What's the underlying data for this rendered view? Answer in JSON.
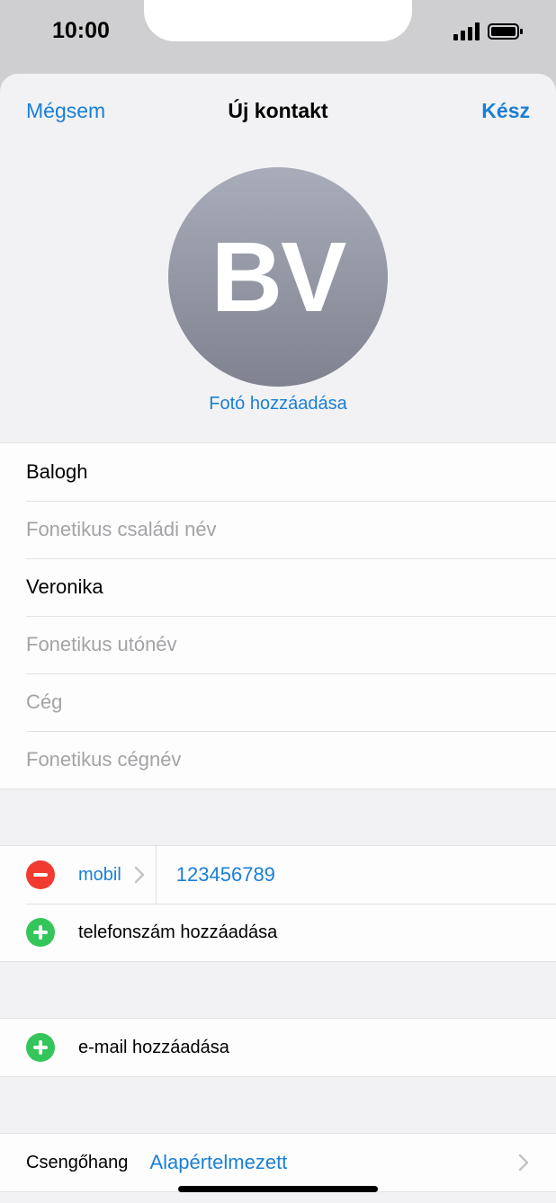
{
  "status": {
    "time": "10:00"
  },
  "nav": {
    "cancel": "Mégsem",
    "title": "Új kontakt",
    "done": "Kész"
  },
  "avatar": {
    "initials": "BV",
    "add_photo": "Fotó hozzáadása"
  },
  "name_fields": {
    "last_name": {
      "value": "Balogh",
      "placeholder": ""
    },
    "phonetic_last": {
      "value": "",
      "placeholder": "Fonetikus családi név"
    },
    "first_name": {
      "value": "Veronika",
      "placeholder": ""
    },
    "phonetic_first": {
      "value": "",
      "placeholder": "Fonetikus utónév"
    },
    "company": {
      "value": "",
      "placeholder": "Cég"
    },
    "phonetic_company": {
      "value": "",
      "placeholder": "Fonetikus cégnév"
    }
  },
  "phone": {
    "label": "mobil",
    "value": "123456789",
    "add_label": "telefonszám hozzáadása"
  },
  "email": {
    "add_label": "e-mail hozzáadása"
  },
  "ringtone": {
    "label": "Csengőhang",
    "value": "Alapértelmezett"
  },
  "colors": {
    "accent": "#1a7fd6",
    "remove": "#f13b30",
    "add": "#34c55b"
  }
}
